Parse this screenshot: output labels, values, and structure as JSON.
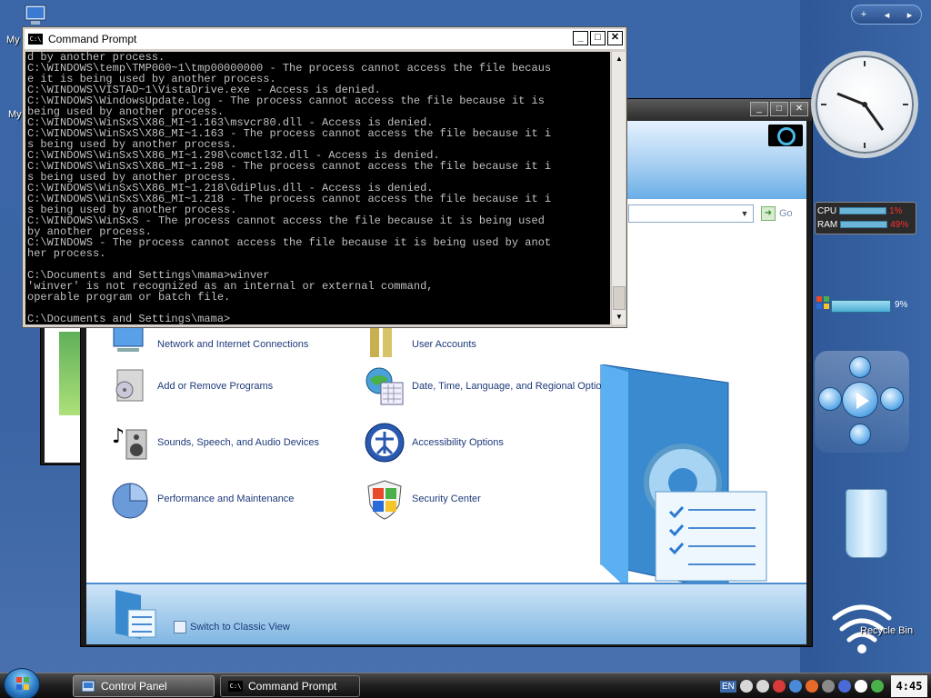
{
  "desktop": {
    "icon_labels": [
      "My",
      "My"
    ]
  },
  "cmd": {
    "title": "Command Prompt",
    "lines": [
      "d by another process.",
      "C:\\WINDOWS\\temp\\TMP000~1\\tmp00000000 - The process cannot access the file becaus",
      "e it is being used by another process.",
      "C:\\WINDOWS\\VISTAD~1\\VistaDrive.exe - Access is denied.",
      "C:\\WINDOWS\\WindowsUpdate.log - The process cannot access the file because it is",
      "being used by another process.",
      "C:\\WINDOWS\\WinSxS\\X86_MI~1.163\\msvcr80.dll - Access is denied.",
      "C:\\WINDOWS\\WinSxS\\X86_MI~1.163 - The process cannot access the file because it i",
      "s being used by another process.",
      "C:\\WINDOWS\\WinSxS\\X86_MI~1.298\\comctl32.dll - Access is denied.",
      "C:\\WINDOWS\\WinSxS\\X86_MI~1.298 - The process cannot access the file because it i",
      "s being used by another process.",
      "C:\\WINDOWS\\WinSxS\\X86_MI~1.218\\GdiPlus.dll - Access is denied.",
      "C:\\WINDOWS\\WinSxS\\X86_MI~1.218 - The process cannot access the file because it i",
      "s being used by another process.",
      "C:\\WINDOWS\\WinSxS - The process cannot access the file because it is being used",
      "by another process.",
      "C:\\WINDOWS - The process cannot access the file because it is being used by anot",
      "her process.",
      "",
      "C:\\Documents and Settings\\mama>winver",
      "'winver' is not recognized as an internal or external command,",
      "operable program or batch file.",
      "",
      "C:\\Documents and Settings\\mama>"
    ]
  },
  "control_panel": {
    "go_label": "Go",
    "categories": [
      {
        "label": "Network and Internet Connections",
        "icon": "network-icon"
      },
      {
        "label": "User Accounts",
        "icon": "users-icon"
      },
      {
        "label": "Add or Remove Programs",
        "icon": "programs-icon"
      },
      {
        "label": "Date, Time, Language, and Regional Options",
        "icon": "globe-clock-icon"
      },
      {
        "label": "Sounds, Speech, and Audio Devices",
        "icon": "speaker-icon"
      },
      {
        "label": "Accessibility Options",
        "icon": "accessibility-icon"
      },
      {
        "label": "Performance and Maintenance",
        "icon": "pie-chart-icon"
      },
      {
        "label": "Security Center",
        "icon": "shield-icon"
      }
    ],
    "classic_view_label": "Switch to Classic View"
  },
  "gadgets": {
    "nav_plus": "+",
    "nav_prev": "◂",
    "nav_next": "▸",
    "cpu_label": "CPU",
    "cpu_value": "1%",
    "ram_label": "RAM",
    "ram_value": "49%",
    "wifi_value": "9%",
    "recycle_label": "Recycle Bin"
  },
  "taskbar": {
    "buttons": [
      {
        "label": "Control Panel",
        "icon": "control-panel-icon"
      },
      {
        "label": "Command Prompt",
        "icon": "cmd-icon"
      }
    ],
    "lang": "EN",
    "clock": "4:45"
  },
  "colors": {
    "desktop": "#3b66a8",
    "console_bg": "#000000",
    "console_fg": "#c0c0c0",
    "taskbar": "#1e1e1e",
    "meter_value": "#ff3030"
  }
}
